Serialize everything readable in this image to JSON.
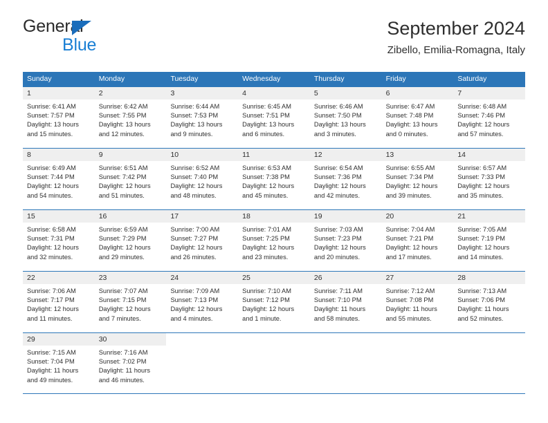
{
  "brand": {
    "name_top": "General",
    "name_bottom": "Blue",
    "triangle_color": "#1a6dbb",
    "blue_text_color": "#1a7fd4"
  },
  "header": {
    "title": "September 2024",
    "subtitle": "Zibello, Emilia-Romagna, Italy"
  },
  "theme": {
    "header_blue": "#2c76b8",
    "daynum_band": "#efefef",
    "text": "#2e2e2e"
  },
  "weekdays": [
    "Sunday",
    "Monday",
    "Tuesday",
    "Wednesday",
    "Thursday",
    "Friday",
    "Saturday"
  ],
  "weeks": [
    [
      {
        "day": "1",
        "sunrise": "Sunrise: 6:41 AM",
        "sunset": "Sunset: 7:57 PM",
        "daylight_1": "Daylight: 13 hours",
        "daylight_2": "and 15 minutes."
      },
      {
        "day": "2",
        "sunrise": "Sunrise: 6:42 AM",
        "sunset": "Sunset: 7:55 PM",
        "daylight_1": "Daylight: 13 hours",
        "daylight_2": "and 12 minutes."
      },
      {
        "day": "3",
        "sunrise": "Sunrise: 6:44 AM",
        "sunset": "Sunset: 7:53 PM",
        "daylight_1": "Daylight: 13 hours",
        "daylight_2": "and 9 minutes."
      },
      {
        "day": "4",
        "sunrise": "Sunrise: 6:45 AM",
        "sunset": "Sunset: 7:51 PM",
        "daylight_1": "Daylight: 13 hours",
        "daylight_2": "and 6 minutes."
      },
      {
        "day": "5",
        "sunrise": "Sunrise: 6:46 AM",
        "sunset": "Sunset: 7:50 PM",
        "daylight_1": "Daylight: 13 hours",
        "daylight_2": "and 3 minutes."
      },
      {
        "day": "6",
        "sunrise": "Sunrise: 6:47 AM",
        "sunset": "Sunset: 7:48 PM",
        "daylight_1": "Daylight: 13 hours",
        "daylight_2": "and 0 minutes."
      },
      {
        "day": "7",
        "sunrise": "Sunrise: 6:48 AM",
        "sunset": "Sunset: 7:46 PM",
        "daylight_1": "Daylight: 12 hours",
        "daylight_2": "and 57 minutes."
      }
    ],
    [
      {
        "day": "8",
        "sunrise": "Sunrise: 6:49 AM",
        "sunset": "Sunset: 7:44 PM",
        "daylight_1": "Daylight: 12 hours",
        "daylight_2": "and 54 minutes."
      },
      {
        "day": "9",
        "sunrise": "Sunrise: 6:51 AM",
        "sunset": "Sunset: 7:42 PM",
        "daylight_1": "Daylight: 12 hours",
        "daylight_2": "and 51 minutes."
      },
      {
        "day": "10",
        "sunrise": "Sunrise: 6:52 AM",
        "sunset": "Sunset: 7:40 PM",
        "daylight_1": "Daylight: 12 hours",
        "daylight_2": "and 48 minutes."
      },
      {
        "day": "11",
        "sunrise": "Sunrise: 6:53 AM",
        "sunset": "Sunset: 7:38 PM",
        "daylight_1": "Daylight: 12 hours",
        "daylight_2": "and 45 minutes."
      },
      {
        "day": "12",
        "sunrise": "Sunrise: 6:54 AM",
        "sunset": "Sunset: 7:36 PM",
        "daylight_1": "Daylight: 12 hours",
        "daylight_2": "and 42 minutes."
      },
      {
        "day": "13",
        "sunrise": "Sunrise: 6:55 AM",
        "sunset": "Sunset: 7:34 PM",
        "daylight_1": "Daylight: 12 hours",
        "daylight_2": "and 39 minutes."
      },
      {
        "day": "14",
        "sunrise": "Sunrise: 6:57 AM",
        "sunset": "Sunset: 7:33 PM",
        "daylight_1": "Daylight: 12 hours",
        "daylight_2": "and 35 minutes."
      }
    ],
    [
      {
        "day": "15",
        "sunrise": "Sunrise: 6:58 AM",
        "sunset": "Sunset: 7:31 PM",
        "daylight_1": "Daylight: 12 hours",
        "daylight_2": "and 32 minutes."
      },
      {
        "day": "16",
        "sunrise": "Sunrise: 6:59 AM",
        "sunset": "Sunset: 7:29 PM",
        "daylight_1": "Daylight: 12 hours",
        "daylight_2": "and 29 minutes."
      },
      {
        "day": "17",
        "sunrise": "Sunrise: 7:00 AM",
        "sunset": "Sunset: 7:27 PM",
        "daylight_1": "Daylight: 12 hours",
        "daylight_2": "and 26 minutes."
      },
      {
        "day": "18",
        "sunrise": "Sunrise: 7:01 AM",
        "sunset": "Sunset: 7:25 PM",
        "daylight_1": "Daylight: 12 hours",
        "daylight_2": "and 23 minutes."
      },
      {
        "day": "19",
        "sunrise": "Sunrise: 7:03 AM",
        "sunset": "Sunset: 7:23 PM",
        "daylight_1": "Daylight: 12 hours",
        "daylight_2": "and 20 minutes."
      },
      {
        "day": "20",
        "sunrise": "Sunrise: 7:04 AM",
        "sunset": "Sunset: 7:21 PM",
        "daylight_1": "Daylight: 12 hours",
        "daylight_2": "and 17 minutes."
      },
      {
        "day": "21",
        "sunrise": "Sunrise: 7:05 AM",
        "sunset": "Sunset: 7:19 PM",
        "daylight_1": "Daylight: 12 hours",
        "daylight_2": "and 14 minutes."
      }
    ],
    [
      {
        "day": "22",
        "sunrise": "Sunrise: 7:06 AM",
        "sunset": "Sunset: 7:17 PM",
        "daylight_1": "Daylight: 12 hours",
        "daylight_2": "and 11 minutes."
      },
      {
        "day": "23",
        "sunrise": "Sunrise: 7:07 AM",
        "sunset": "Sunset: 7:15 PM",
        "daylight_1": "Daylight: 12 hours",
        "daylight_2": "and 7 minutes."
      },
      {
        "day": "24",
        "sunrise": "Sunrise: 7:09 AM",
        "sunset": "Sunset: 7:13 PM",
        "daylight_1": "Daylight: 12 hours",
        "daylight_2": "and 4 minutes."
      },
      {
        "day": "25",
        "sunrise": "Sunrise: 7:10 AM",
        "sunset": "Sunset: 7:12 PM",
        "daylight_1": "Daylight: 12 hours",
        "daylight_2": "and 1 minute."
      },
      {
        "day": "26",
        "sunrise": "Sunrise: 7:11 AM",
        "sunset": "Sunset: 7:10 PM",
        "daylight_1": "Daylight: 11 hours",
        "daylight_2": "and 58 minutes."
      },
      {
        "day": "27",
        "sunrise": "Sunrise: 7:12 AM",
        "sunset": "Sunset: 7:08 PM",
        "daylight_1": "Daylight: 11 hours",
        "daylight_2": "and 55 minutes."
      },
      {
        "day": "28",
        "sunrise": "Sunrise: 7:13 AM",
        "sunset": "Sunset: 7:06 PM",
        "daylight_1": "Daylight: 11 hours",
        "daylight_2": "and 52 minutes."
      }
    ],
    [
      {
        "day": "29",
        "sunrise": "Sunrise: 7:15 AM",
        "sunset": "Sunset: 7:04 PM",
        "daylight_1": "Daylight: 11 hours",
        "daylight_2": "and 49 minutes."
      },
      {
        "day": "30",
        "sunrise": "Sunrise: 7:16 AM",
        "sunset": "Sunset: 7:02 PM",
        "daylight_1": "Daylight: 11 hours",
        "daylight_2": "and 46 minutes."
      },
      {
        "day": "",
        "sunrise": "",
        "sunset": "",
        "daylight_1": "",
        "daylight_2": ""
      },
      {
        "day": "",
        "sunrise": "",
        "sunset": "",
        "daylight_1": "",
        "daylight_2": ""
      },
      {
        "day": "",
        "sunrise": "",
        "sunset": "",
        "daylight_1": "",
        "daylight_2": ""
      },
      {
        "day": "",
        "sunrise": "",
        "sunset": "",
        "daylight_1": "",
        "daylight_2": ""
      },
      {
        "day": "",
        "sunrise": "",
        "sunset": "",
        "daylight_1": "",
        "daylight_2": ""
      }
    ]
  ]
}
